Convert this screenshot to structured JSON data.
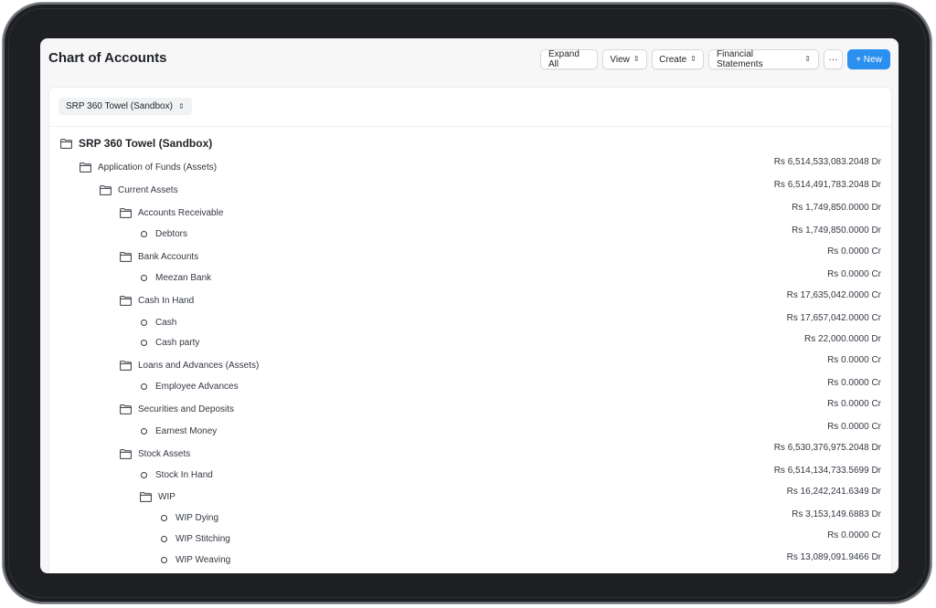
{
  "page": {
    "title": "Chart of Accounts"
  },
  "toolbar": {
    "expand_all": "Expand All",
    "view": "View",
    "create": "Create",
    "financial_statements": "Financial Statements",
    "more": "···",
    "new": "+ New"
  },
  "filter": {
    "company": "SRP 360 Towel (Sandbox)"
  },
  "tree": {
    "root": "SRP 360 Towel (Sandbox)",
    "rows": [
      {
        "label": "Application of Funds (Assets)",
        "amount": "Rs 6,514,533,083.2048 Dr",
        "type": "group",
        "level": 1
      },
      {
        "label": "Current Assets",
        "amount": "Rs 6,514,491,783.2048 Dr",
        "type": "group",
        "level": 2
      },
      {
        "label": "Accounts Receivable",
        "amount": "Rs 1,749,850.0000 Dr",
        "type": "group",
        "level": 3
      },
      {
        "label": "Debtors",
        "amount": "Rs 1,749,850.0000 Dr",
        "type": "leaf",
        "level": 4
      },
      {
        "label": "Bank Accounts",
        "amount": "Rs 0.0000 Cr",
        "type": "group",
        "level": 3
      },
      {
        "label": "Meezan Bank",
        "amount": "Rs 0.0000 Cr",
        "type": "leaf",
        "level": 4
      },
      {
        "label": "Cash In Hand",
        "amount": "Rs 17,635,042.0000 Cr",
        "type": "group",
        "level": 3
      },
      {
        "label": "Cash",
        "amount": "Rs 17,657,042.0000 Cr",
        "type": "leaf",
        "level": 4
      },
      {
        "label": "Cash party",
        "amount": "Rs 22,000.0000 Dr",
        "type": "leaf",
        "level": 4
      },
      {
        "label": "Loans and Advances (Assets)",
        "amount": "Rs 0.0000 Cr",
        "type": "group",
        "level": 3
      },
      {
        "label": "Employee Advances",
        "amount": "Rs 0.0000 Cr",
        "type": "leaf",
        "level": 4
      },
      {
        "label": "Securities and Deposits",
        "amount": "Rs 0.0000 Cr",
        "type": "group",
        "level": 3
      },
      {
        "label": "Earnest Money",
        "amount": "Rs 0.0000 Cr",
        "type": "leaf",
        "level": 4
      },
      {
        "label": "Stock Assets",
        "amount": "Rs 6,530,376,975.2048 Dr",
        "type": "group",
        "level": 3
      },
      {
        "label": "Stock In Hand",
        "amount": "Rs 6,514,134,733.5699 Dr",
        "type": "leaf",
        "level": 4
      },
      {
        "label": "WIP",
        "amount": "Rs 16,242,241.6349 Dr",
        "type": "group",
        "level": 4
      },
      {
        "label": "WIP Dying",
        "amount": "Rs 3,153,149.6883 Dr",
        "type": "leaf",
        "level": 5
      },
      {
        "label": "WIP Stitching",
        "amount": "Rs 0.0000 Cr",
        "type": "leaf",
        "level": 5
      },
      {
        "label": "WIP Weaving",
        "amount": "Rs 13,089,091.9466 Dr",
        "type": "leaf",
        "level": 5
      }
    ]
  }
}
